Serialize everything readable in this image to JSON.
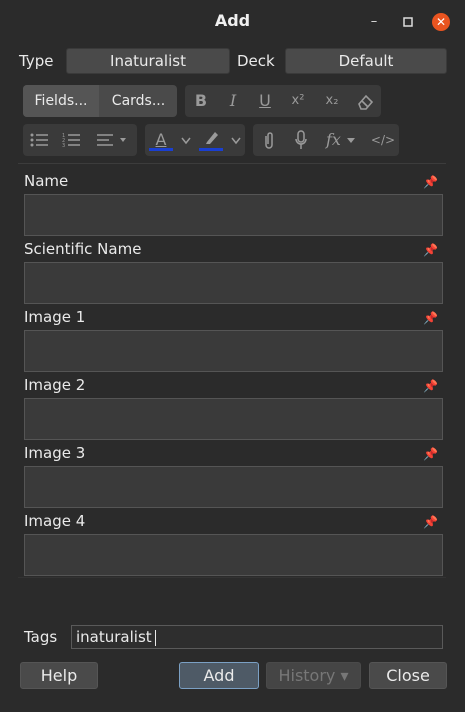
{
  "window": {
    "title": "Add",
    "minimize": "–",
    "maximize": "▫",
    "close": "✕"
  },
  "type_label": "Type",
  "type_value": "Inaturalist",
  "deck_label": "Deck",
  "deck_value": "Default",
  "toolbar": {
    "fields_button": "Fields...",
    "cards_button": "Cards...",
    "bold": "B",
    "italic": "I",
    "underline": "U",
    "superscript": "x²",
    "subscript": "x₂",
    "text_color": "A",
    "mathjax": "fx",
    "html": "</>",
    "icons": [
      "eraser-icon",
      "bullet-list-icon",
      "numbered-list-icon",
      "align-icon",
      "highlight-icon",
      "paperclip-icon",
      "microphone-icon",
      "code-icon"
    ]
  },
  "fields": [
    {
      "name": "Name",
      "value": ""
    },
    {
      "name": "Scientific Name",
      "value": ""
    },
    {
      "name": "Image 1",
      "value": ""
    },
    {
      "name": "Image 2",
      "value": ""
    },
    {
      "name": "Image 3",
      "value": ""
    },
    {
      "name": "Image 4",
      "value": ""
    }
  ],
  "tags_label": "Tags",
  "tags_value": "inaturalist",
  "buttons": {
    "help": "Help",
    "add": "Add",
    "history": "History ▾",
    "close": "Close"
  },
  "colors": {
    "background": "#2b2b2b",
    "field": "#3a3a3a",
    "close_accent": "#e95420",
    "text_color_bar": "#1a3fd1",
    "highlight_bar": "#1a3fd1"
  }
}
